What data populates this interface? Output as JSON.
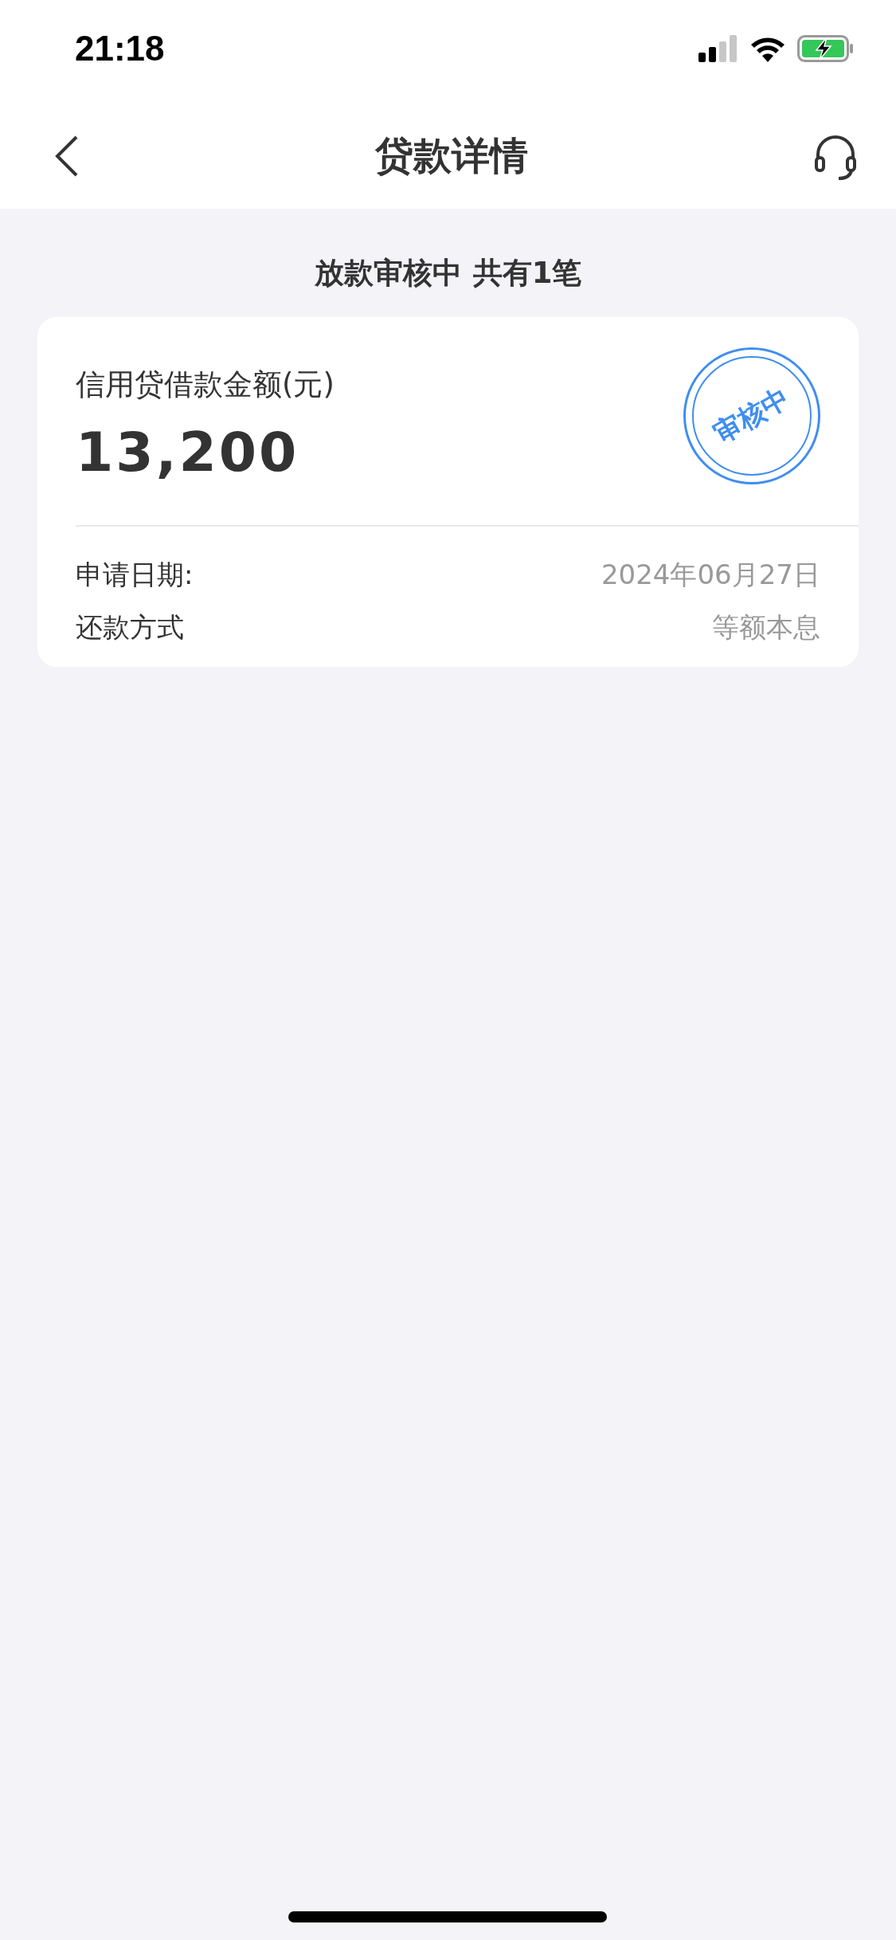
{
  "status_bar": {
    "time": "21:18"
  },
  "nav_bar": {
    "title": "贷款详情"
  },
  "summary": {
    "status": "放款审核中",
    "count_text": "共有1笔"
  },
  "loan_card": {
    "amount_label": "信用贷借款金额(元)",
    "amount": "13,200",
    "stamp": "审核中",
    "details": [
      {
        "label": "申请日期:",
        "value": "2024年06月27日"
      },
      {
        "label": "还款方式",
        "value": "等额本息"
      }
    ]
  }
}
